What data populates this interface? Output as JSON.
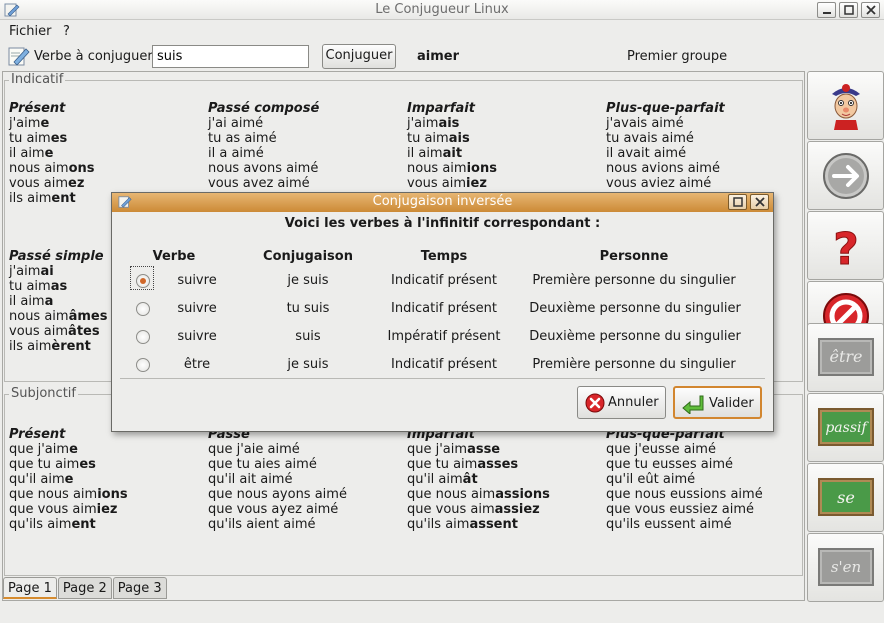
{
  "window": {
    "title": "Le Conjugueur Linux"
  },
  "menu": {
    "file": "Fichier",
    "help": "?"
  },
  "toolbar": {
    "verb_label": "Verbe à conjuguer",
    "verb_value": "suis",
    "conjugate_button": "Conjuguer",
    "infinitive": "aimer",
    "group": "Premier groupe"
  },
  "indicatif": {
    "title": "Indicatif",
    "present": {
      "tense": "Présent",
      "lines": [
        [
          "j'aim",
          "e"
        ],
        [
          "tu aim",
          "es"
        ],
        [
          "il aim",
          "e"
        ],
        [
          "nous aim",
          "ons"
        ],
        [
          "vous aim",
          "ez"
        ],
        [
          "ils aim",
          "ent"
        ]
      ]
    },
    "passe_compose": {
      "tense": "Passé composé",
      "lines": [
        "j'ai aimé",
        "tu as aimé",
        "il a aimé",
        "nous avons aimé",
        "vous avez aimé"
      ]
    },
    "imparfait": {
      "tense": "Imparfait",
      "lines": [
        [
          "j'aim",
          "ais"
        ],
        [
          "tu aim",
          "ais"
        ],
        [
          "il aim",
          "ait"
        ],
        [
          "nous aim",
          "ions"
        ],
        [
          "vous aim",
          "iez"
        ]
      ]
    },
    "plus_que_parfait": {
      "tense": "Plus-que-parfait",
      "lines": [
        "j'avais aimé",
        "tu avais aimé",
        "il avait aimé",
        "nous avions aimé",
        "vous aviez aimé"
      ]
    },
    "passe_simple": {
      "tense": "Passé simple",
      "lines": [
        [
          "j'aim",
          "ai"
        ],
        [
          "tu aim",
          "as"
        ],
        [
          "il aim",
          "a"
        ],
        [
          "nous aim",
          "âmes"
        ],
        [
          "vous aim",
          "âtes"
        ],
        [
          "ils aim",
          "èrent"
        ]
      ]
    }
  },
  "subjonctif": {
    "title": "Subjonctif",
    "present": {
      "tense": "Présent",
      "lines": [
        [
          "que j'aim",
          "e"
        ],
        [
          "que tu aim",
          "es"
        ],
        [
          "qu'il aim",
          "e"
        ],
        [
          "que nous aim",
          "ions"
        ],
        [
          "que vous aim",
          "iez"
        ],
        [
          "qu'ils aim",
          "ent"
        ]
      ]
    },
    "passe": {
      "tense": "Passé",
      "lines": [
        "que j'aie aimé",
        "que tu aies aimé",
        "qu'il ait aimé",
        "que nous ayons aimé",
        "que vous ayez aimé",
        "qu'ils aient aimé"
      ]
    },
    "imparfait": {
      "tense": "Imparfait",
      "lines": [
        [
          "que j'aim",
          "asse"
        ],
        [
          "que tu aim",
          "asses"
        ],
        [
          "qu'il aim",
          "ât"
        ],
        [
          "que nous aim",
          "assions"
        ],
        [
          "que vous aim",
          "assiez"
        ],
        [
          "qu'ils aim",
          "assent"
        ]
      ]
    },
    "plus_que_parfait": {
      "tense": "Plus-que-parfait",
      "lines": [
        "que j'eusse aimé",
        "que tu eusses aimé",
        "qu'il eût aimé",
        "que nous eussions aimé",
        "que vous eussiez aimé",
        "qu'ils eussent aimé"
      ]
    }
  },
  "tabs": [
    "Page 1",
    "Page 2",
    "Page 3"
  ],
  "sidebar": {
    "etre": "être",
    "passif": "passif",
    "se": "se",
    "sen": "s'en"
  },
  "dialog": {
    "title": "Conjugaison inversée",
    "heading": "Voici les verbes à l'infinitif correspondant :",
    "columns": [
      "Verbe",
      "Conjugaison",
      "Temps",
      "Personne"
    ],
    "rows": [
      {
        "verbe": "suivre",
        "conjugaison": "je suis",
        "temps": "Indicatif présent",
        "personne": "Première personne du singulier",
        "selected": true
      },
      {
        "verbe": "suivre",
        "conjugaison": "tu suis",
        "temps": "Indicatif présent",
        "personne": "Deuxième personne du singulier",
        "selected": false
      },
      {
        "verbe": "suivre",
        "conjugaison": "suis",
        "temps": "Impératif présent",
        "personne": "Deuxième personne du singulier",
        "selected": false
      },
      {
        "verbe": "être",
        "conjugaison": "je suis",
        "temps": "Indicatif présent",
        "personne": "Première personne du singulier",
        "selected": false
      }
    ],
    "cancel_label": "Annuler",
    "ok_label": "Valider"
  },
  "colors": {
    "accent": "#d2862f",
    "dialog_title": "#cc8a36",
    "cancel_red": "#d8262a",
    "ok_green": "#3f9a2a",
    "board_green": "#4a9a48"
  }
}
